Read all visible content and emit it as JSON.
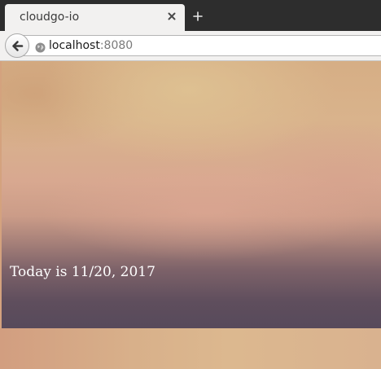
{
  "browser": {
    "tab": {
      "title": "cloudgo-io"
    },
    "address_bar": {
      "host": "localhost",
      "port": ":8080"
    }
  },
  "page": {
    "date_text": "Today is 11/20, 2017"
  },
  "icons": {
    "back": "back-arrow-icon",
    "close_tab": "close-icon",
    "new_tab": "plus-icon",
    "site_identity": "globe-icon"
  }
}
